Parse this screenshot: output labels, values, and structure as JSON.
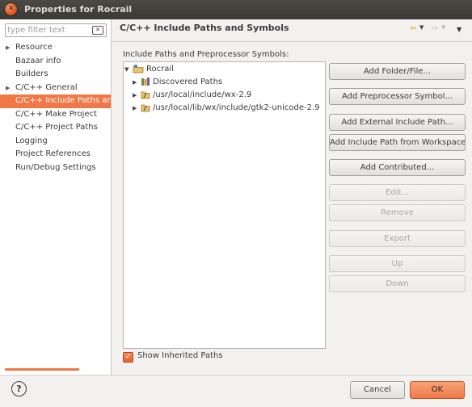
{
  "window": {
    "title": "Properties for Rocrail"
  },
  "filter": {
    "placeholder": "type filter text"
  },
  "nav": {
    "items": [
      {
        "label": "Resource",
        "expandable": true
      },
      {
        "label": "Bazaar info",
        "expandable": false
      },
      {
        "label": "Builders",
        "expandable": false
      },
      {
        "label": "C/C++ General",
        "expandable": true
      },
      {
        "label": "C/C++ Include Paths and",
        "expandable": false,
        "selected": true
      },
      {
        "label": "C/C++ Make Project",
        "expandable": false
      },
      {
        "label": "C/C++ Project Paths",
        "expandable": false
      },
      {
        "label": "Logging",
        "expandable": false
      },
      {
        "label": "Project References",
        "expandable": false
      },
      {
        "label": "Run/Debug Settings",
        "expandable": false
      }
    ]
  },
  "page": {
    "title": "C/C++ Include Paths and Symbols",
    "tree_label": "Include Paths and Preprocessor Symbols:",
    "tree": {
      "root": "Rocrail",
      "children": [
        "Discovered Paths",
        "/usr/local/include/wx-2.9",
        "/usr/local/lib/wx/include/gtk2-unicode-2.9"
      ]
    },
    "buttons": {
      "add_folder": "Add Folder/File...",
      "add_symbol": "Add Preprocessor Symbol...",
      "add_external": "Add External Include Path...",
      "add_workspace": "Add Include Path from Workspace...",
      "add_contributed": "Add Contributed...",
      "edit": "Edit...",
      "remove": "Remove",
      "export": "Export",
      "up": "Up",
      "down": "Down"
    },
    "show_inherited": {
      "label": "Show Inherited Paths",
      "checked": true
    }
  },
  "footer": {
    "help": "?",
    "cancel": "Cancel",
    "ok": "OK"
  },
  "colors": {
    "accent": "#f07746",
    "titlebar": "#3c3b37"
  }
}
